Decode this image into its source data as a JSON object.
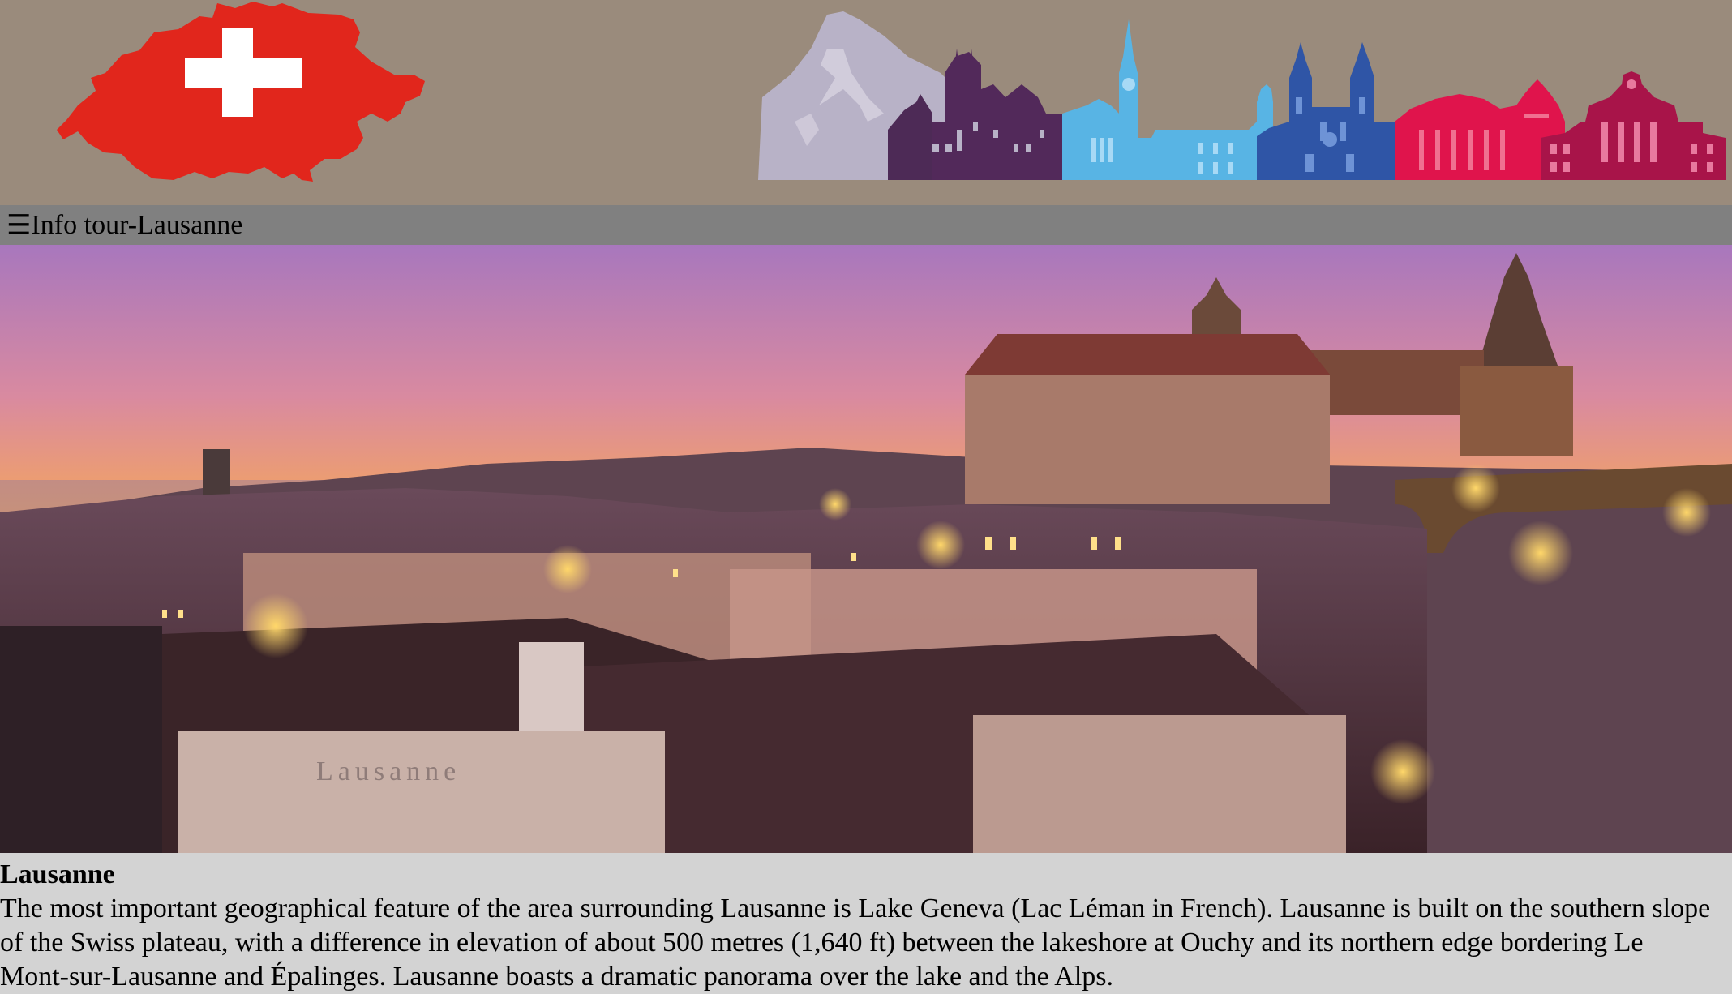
{
  "header": {
    "flag_map_label": "Switzerland flag map",
    "skyline_label": "Swiss landmarks skyline"
  },
  "navbar": {
    "menu_glyph": "☰",
    "title": "Info tour-Lausanne"
  },
  "hero": {
    "watermark": "Lausanne"
  },
  "article": {
    "heading": "Lausanne",
    "body": "The most important geographical feature of the area surrounding Lausanne is Lake Geneva (Lac Léman in French). Lausanne is built on the southern slope of the Swiss plateau, with a difference in elevation of about 500 metres (1,640 ft) between the lakeshore at Ouchy and its northern edge bordering Le Mont-sur-Lausanne and Épalinges. Lausanne boasts a dramatic panorama over the lake and the Alps."
  },
  "colors": {
    "header_bg": "#9a8b7c",
    "navbar_bg": "#808080",
    "page_bg": "#d3d3d3",
    "swiss_red": "#e1261c"
  }
}
